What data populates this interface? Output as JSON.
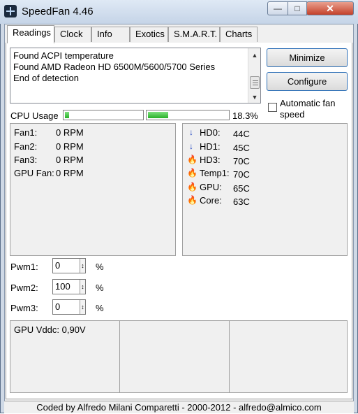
{
  "window": {
    "title": "SpeedFan 4.46"
  },
  "tabs": [
    {
      "label": "Readings",
      "active": true
    },
    {
      "label": "Clock"
    },
    {
      "label": "Info"
    },
    {
      "label": "Exotics"
    },
    {
      "label": "S.M.A.R.T."
    },
    {
      "label": "Charts"
    }
  ],
  "log": {
    "lines": [
      "Found ACPI temperature",
      "Found AMD Radeon HD 6500M/5600/5700 Series",
      "End of detection"
    ]
  },
  "buttons": {
    "minimize": "Minimize",
    "configure": "Configure"
  },
  "auto_fan_speed": {
    "label": "Automatic fan speed",
    "checked": false
  },
  "cpu_usage": {
    "label": "CPU Usage",
    "bar1_fill": 0.05,
    "bar2_fill": 0.25,
    "percent": "18.3%"
  },
  "fans": [
    {
      "label": "Fan1:",
      "value": "0 RPM"
    },
    {
      "label": "Fan2:",
      "value": "0 RPM"
    },
    {
      "label": "Fan3:",
      "value": "0 RPM"
    },
    {
      "label": "GPU Fan:",
      "value": "0 RPM"
    }
  ],
  "temps": [
    {
      "label": "HD0:",
      "value": "44C",
      "icon": "arrow-down-icon"
    },
    {
      "label": "HD1:",
      "value": "45C",
      "icon": "arrow-down-icon"
    },
    {
      "label": "HD3:",
      "value": "70C",
      "icon": "flame-icon"
    },
    {
      "label": "Temp1:",
      "value": "70C",
      "icon": "flame-icon"
    },
    {
      "label": "GPU:",
      "value": "65C",
      "icon": "flame-icon"
    },
    {
      "label": "Core:",
      "value": "63C",
      "icon": "flame-icon"
    }
  ],
  "pwm": [
    {
      "label": "Pwm1:",
      "value": "0",
      "unit": "%"
    },
    {
      "label": "Pwm2:",
      "value": "100",
      "unit": "%"
    },
    {
      "label": "Pwm3:",
      "value": "0",
      "unit": "%"
    }
  ],
  "voltages": {
    "gpu_vddc": "GPU Vddc:  0,90V"
  },
  "footer": "Coded by Alfredo Milani Comparetti - 2000-2012 - alfredo@almico.com",
  "colors": {
    "accent": "#2d6fb7",
    "bar_fill": "#28b028",
    "flame": "#e23b1a",
    "arrow": "#1a3fc0"
  }
}
